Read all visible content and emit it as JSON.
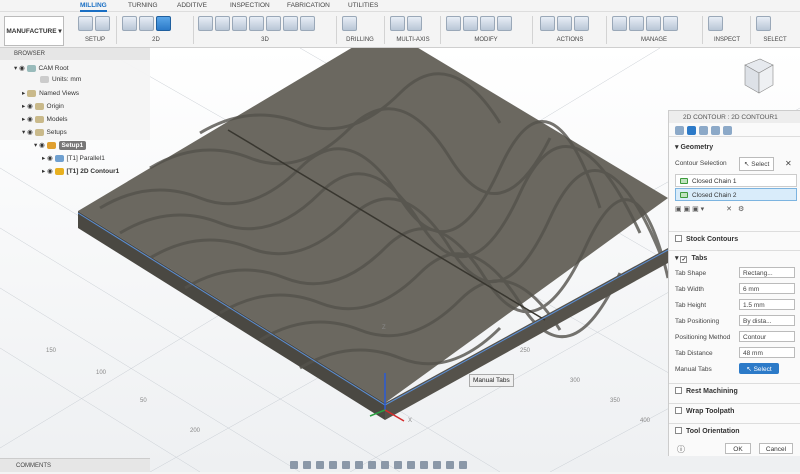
{
  "tabs": [
    "MILLING",
    "TURNING",
    "ADDITIVE",
    "INSPECTION",
    "FABRICATION",
    "UTILITIES"
  ],
  "workspace": "MANUFACTURE",
  "toolbar_groups": [
    "SETUP",
    "2D",
    "3D",
    "DRILLING",
    "MULTI-AXIS",
    "MODIFY",
    "ACTIONS",
    "MANAGE",
    "INSPECT",
    "SELECT"
  ],
  "browser": {
    "title": "BROWSER",
    "items": [
      "CAM Root",
      "Units: mm",
      "Named Views",
      "Origin",
      "Models",
      "Setups",
      "Setup1",
      "[T1] Parallel1",
      "[T1] 2D Contour1"
    ]
  },
  "panel": {
    "title": "2D CONTOUR : 2D CONTOUR1",
    "geometry": "Geometry",
    "contour_selection_label": "Contour Selection",
    "select_label": "Select",
    "chains": [
      "Closed Chain 1",
      "Closed Chain 2"
    ],
    "stock_contours": "Stock Contours",
    "tabs_section": "Tabs",
    "fields": [
      {
        "label": "Tab Shape",
        "value": "Rectang..."
      },
      {
        "label": "Tab Width",
        "value": "6 mm"
      },
      {
        "label": "Tab Height",
        "value": "1.5 mm"
      },
      {
        "label": "Tab Positioning",
        "value": "By dista..."
      },
      {
        "label": "Positioning Method",
        "value": "Contour"
      },
      {
        "label": "Tab Distance",
        "value": "48 mm"
      }
    ],
    "manual_tabs_label": "Manual Tabs",
    "manual_tabs_button": "Select",
    "rest_machining": "Rest Machining",
    "wrap_toolpath": "Wrap Toolpath",
    "tool_orientation": "Tool Orientation",
    "ok": "OK",
    "cancel": "Cancel"
  },
  "tooltip": "Manual Tabs",
  "comments": "COMMENTS",
  "axis_labels": [
    "150",
    "100",
    "50",
    "200",
    "250",
    "300",
    "350",
    "400",
    "Z",
    "X",
    "Y"
  ],
  "colors": {
    "accent": "#2c7ac8",
    "model": "#6b6860",
    "model_dark": "#4a4842"
  }
}
